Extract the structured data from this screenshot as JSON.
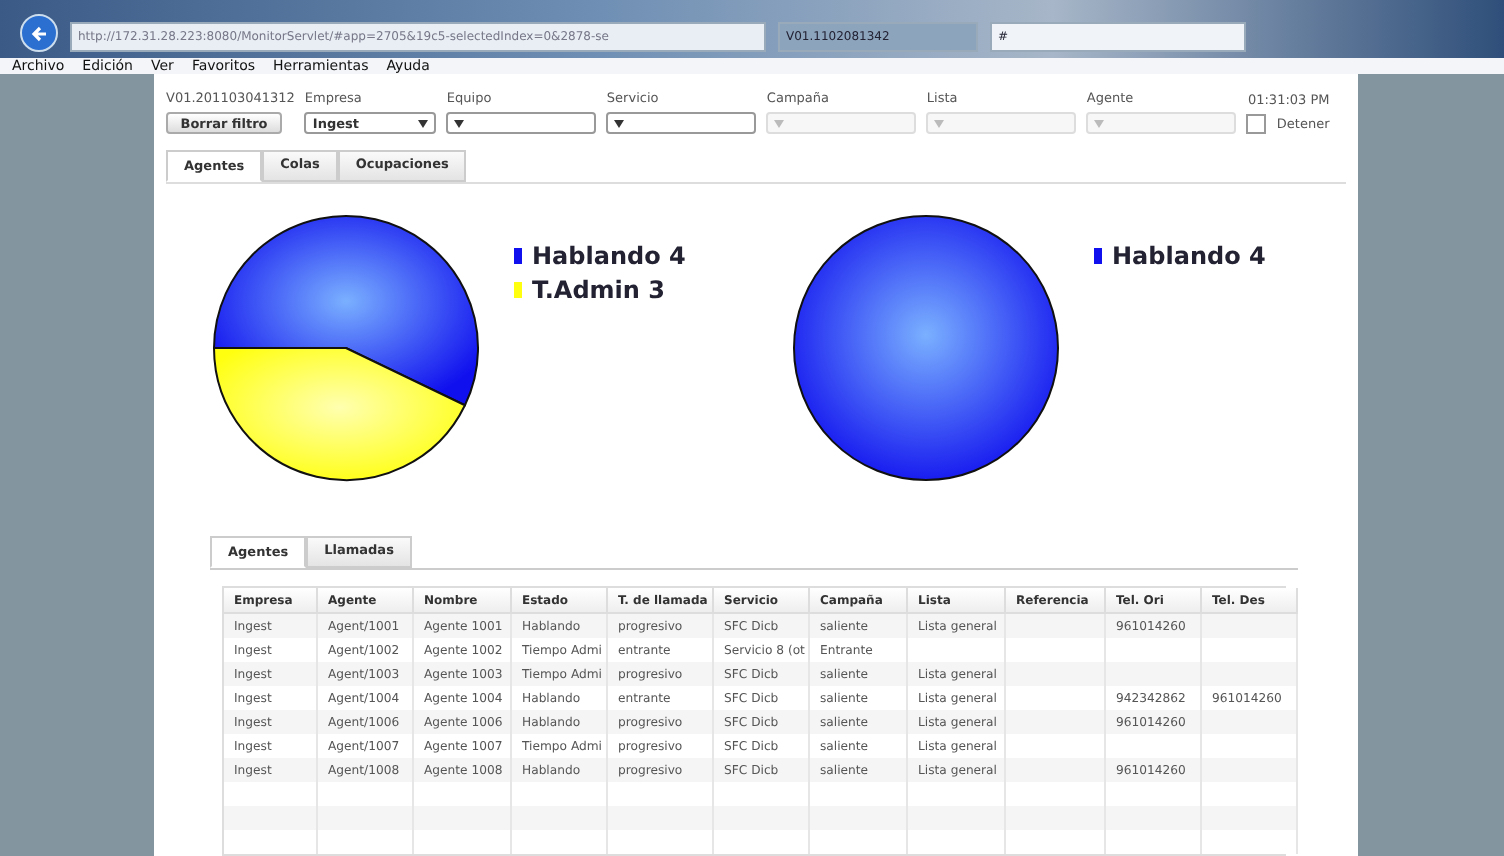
{
  "browser": {
    "address": "http://172.31.28.223:8080/MonitorServlet/#app=2705&19c5-selectedIndex=0&2878-se",
    "tabs": [
      {
        "title": "V01.1102081342",
        "selected": false
      },
      {
        "title": "#",
        "selected": true
      }
    ]
  },
  "menu": [
    "Archivo",
    "Edición",
    "Ver",
    "Favoritos",
    "Herramientas",
    "Ayuda"
  ],
  "version": "V01.201103041312",
  "clock": "01:31:03 PM",
  "clear_button": "Borrar filtro",
  "filters": [
    {
      "label": "Empresa",
      "value": "Ingest",
      "disabled": false
    },
    {
      "label": "Equipo",
      "disabled": false
    },
    {
      "label": "Servicio",
      "disabled": false
    },
    {
      "label": "Campaña",
      "disabled": true
    },
    {
      "label": "Lista",
      "disabled": true
    },
    {
      "label": "Agente",
      "disabled": true
    }
  ],
  "stop": {
    "label": "Detener",
    "checked": false
  },
  "tabs": [
    {
      "label": "Agentes",
      "selected": true
    },
    {
      "label": "Colas",
      "selected": false
    },
    {
      "label": "Ocupaciones",
      "selected": false
    }
  ],
  "charts": [
    {
      "chart_data": {
        "type": "pie",
        "categories": [
          "Hablando 4",
          "T.Admin 3"
        ],
        "values": [
          4,
          3
        ]
      }
    },
    {
      "chart_data": {
        "type": "pie",
        "categories": [
          "Hablando 4"
        ],
        "values": [
          4
        ]
      }
    }
  ],
  "lower_tabs": [
    {
      "label": "Agentes",
      "selected": true
    },
    {
      "label": "Llamadas",
      "selected": false
    }
  ],
  "table": {
    "columns": [
      "Empresa",
      "Agente",
      "Nombre",
      "Estado",
      "T. de llamada",
      "Servicio",
      "Campaña",
      "Lista",
      "Referencia",
      "Tel. Ori",
      "Tel. Des"
    ],
    "rows": [
      [
        "Ingest",
        "Agent/1001",
        "Agente 1001",
        "Hablando",
        "progresivo",
        "SFC Dicb",
        "saliente",
        "Lista general",
        "",
        "961014260",
        ""
      ],
      [
        "Ingest",
        "Agent/1002",
        "Agente 1002",
        "Tiempo Admi",
        "entrante",
        "Servicio 8 (ot",
        "Entrante",
        "",
        "",
        "",
        ""
      ],
      [
        "Ingest",
        "Agent/1003",
        "Agente 1003",
        "Tiempo Admi",
        "progresivo",
        "SFC Dicb",
        "saliente",
        "Lista general",
        "",
        "",
        ""
      ],
      [
        "Ingest",
        "Agent/1004",
        "Agente 1004",
        "Hablando",
        "entrante",
        "SFC Dicb",
        "saliente",
        "Lista general",
        "",
        "942342862",
        "961014260"
      ],
      [
        "Ingest",
        "Agent/1006",
        "Agente 1006",
        "Hablando",
        "progresivo",
        "SFC Dicb",
        "saliente",
        "Lista general",
        "",
        "961014260",
        ""
      ],
      [
        "Ingest",
        "Agent/1007",
        "Agente 1007",
        "Tiempo Admi",
        "progresivo",
        "SFC Dicb",
        "saliente",
        "Lista general",
        "",
        "",
        ""
      ],
      [
        "Ingest",
        "Agent/1008",
        "Agente 1008",
        "Hablando",
        "progresivo",
        "SFC Dicb",
        "saliente",
        "Lista general",
        "",
        "961014260",
        ""
      ]
    ]
  }
}
